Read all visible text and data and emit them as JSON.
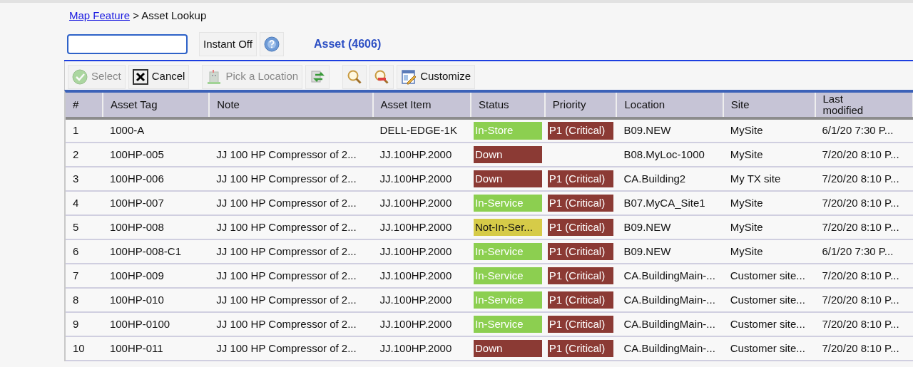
{
  "breadcrumb": {
    "link": "Map Feature",
    "separator": ">",
    "current": "Asset Lookup"
  },
  "instant_button": "Instant Off",
  "count_label": "Asset (4606)",
  "toolbar": [
    {
      "kind": "select",
      "label": "Select",
      "disabled": true
    },
    {
      "kind": "cancel",
      "label": "Cancel",
      "disabled": false
    },
    {
      "kind": "location",
      "label": "Pick a Location",
      "disabled": true
    },
    {
      "kind": "refresh",
      "disabled": false
    },
    {
      "kind": "search",
      "disabled": false
    },
    {
      "kind": "clear-search",
      "disabled": false
    },
    {
      "kind": "customize",
      "label": "Customize",
      "disabled": false
    }
  ],
  "table": {
    "columns": [
      "#",
      "Asset Tag",
      "Note",
      "Asset Item",
      "Status",
      "Priority",
      "Location",
      "Site",
      "Last modified"
    ],
    "rows": [
      {
        "num": "1",
        "tag": "1000-A",
        "item": "DELL-EDGE-1K",
        "status": {
          "text": "In-Store",
          "color": "#8ccf50"
        },
        "priority": {
          "text": "P1 (Critical)",
          "color": "#8b3a34"
        },
        "location": "B09.NEW",
        "site": "MySite",
        "modified": "6/1/20 7:30 P..."
      },
      {
        "num": "2",
        "tag": "100HP-005",
        "note": "JJ 100 HP Compressor of 2...",
        "item": "JJ.100HP.2000",
        "status": {
          "text": "Down",
          "color": "#8b3a34"
        },
        "location": "B08.MyLoc-1000",
        "site": "MySite",
        "modified": "7/20/20 8:10 P..."
      },
      {
        "num": "3",
        "tag": "100HP-006",
        "note": "JJ 100 HP Compressor of 2...",
        "item": "JJ.100HP.2000",
        "status": {
          "text": "Down",
          "color": "#8b3a34"
        },
        "priority": {
          "text": "P1 (Critical)",
          "color": "#8b3a34"
        },
        "location": "CA.Building2",
        "site": "My TX site",
        "modified": "7/20/20 8:10 P..."
      },
      {
        "num": "4",
        "tag": "100HP-007",
        "note": "JJ 100 HP Compressor of 2...",
        "item": "JJ.100HP.2000",
        "status": {
          "text": "In-Service",
          "color": "#8ccf50"
        },
        "priority": {
          "text": "P1 (Critical)",
          "color": "#8b3a34"
        },
        "location": "B07.MyCA_Site1",
        "site": "MySite",
        "modified": "7/20/20 8:10 P..."
      },
      {
        "num": "5",
        "tag": "100HP-008",
        "note": "JJ 100 HP Compressor of 2...",
        "item": "JJ.100HP.2000",
        "status": {
          "text": "Not-In-Ser...",
          "color": "#d6cb48"
        },
        "priority": {
          "text": "P1 (Critical)",
          "color": "#8b3a34"
        },
        "location": "B09.NEW",
        "site": "MySite",
        "modified": "7/20/20 8:10 P..."
      },
      {
        "num": "6",
        "tag": "100HP-008-C1",
        "note": "JJ 100 HP Compressor of 2...",
        "item": "JJ.100HP.2000",
        "status": {
          "text": "In-Service",
          "color": "#8ccf50"
        },
        "priority": {
          "text": "P1 (Critical)",
          "color": "#8b3a34"
        },
        "location": "B09.NEW",
        "site": "MySite",
        "modified": "6/1/20 7:30 P..."
      },
      {
        "num": "7",
        "tag": "100HP-009",
        "note": "JJ 100 HP Compressor of 2...",
        "item": "JJ.100HP.2000",
        "status": {
          "text": "In-Service",
          "color": "#8ccf50"
        },
        "priority": {
          "text": "P1 (Critical)",
          "color": "#8b3a34"
        },
        "location": "CA.BuildingMain-...",
        "site": "Customer site...",
        "modified": "7/20/20 8:10 P..."
      },
      {
        "num": "8",
        "tag": "100HP-010",
        "note": "JJ 100 HP Compressor of 2...",
        "item": "JJ.100HP.2000",
        "status": {
          "text": "In-Service",
          "color": "#8ccf50"
        },
        "priority": {
          "text": "P1 (Critical)",
          "color": "#8b3a34"
        },
        "location": "CA.BuildingMain-...",
        "site": "Customer site...",
        "modified": "7/20/20 8:10 P..."
      },
      {
        "num": "9",
        "tag": "100HP-0100",
        "note": "JJ 100 HP Compressor of 2...",
        "item": "JJ.100HP.2000",
        "status": {
          "text": "In-Service",
          "color": "#8ccf50"
        },
        "priority": {
          "text": "P1 (Critical)",
          "color": "#8b3a34"
        },
        "location": "CA.BuildingMain-...",
        "site": "Customer site...",
        "modified": "7/20/20 8:10 P..."
      },
      {
        "num": "10",
        "tag": "100HP-011",
        "note": "JJ 100 HP Compressor of 2...",
        "item": "JJ.100HP.2000",
        "status": {
          "text": "Down",
          "color": "#8b3a34"
        },
        "priority": {
          "text": "P1 (Critical)",
          "color": "#8b3a34"
        },
        "location": "CA.BuildingMain-...",
        "site": "Customer site...",
        "modified": "7/20/20 8:10 P..."
      }
    ]
  }
}
